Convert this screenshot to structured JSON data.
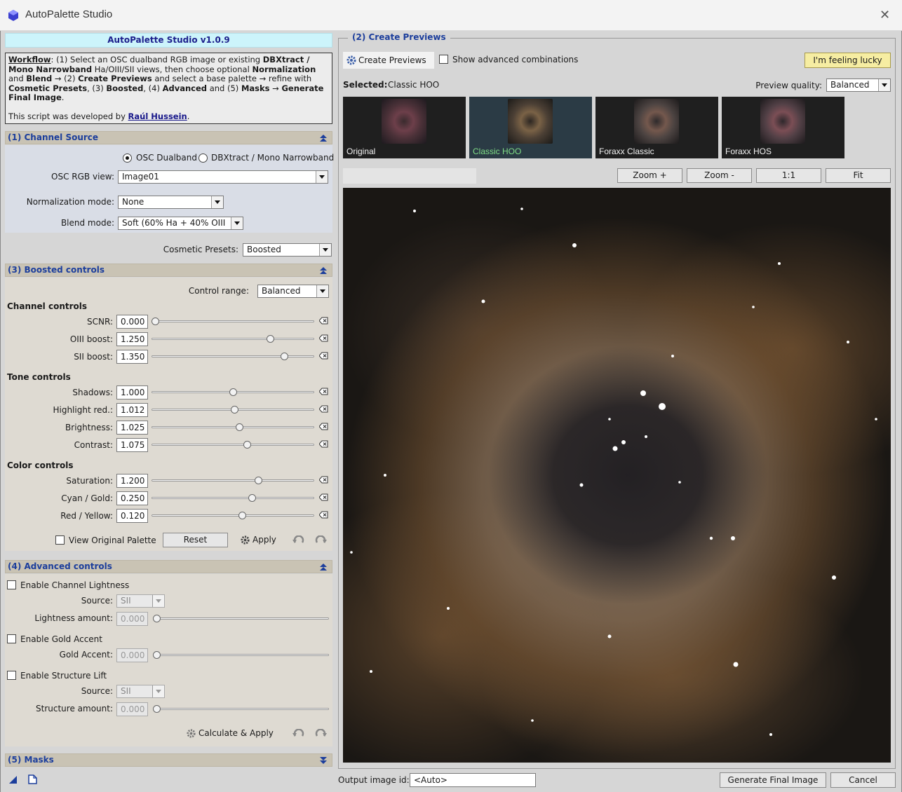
{
  "window": {
    "title": "AutoPalette Studio"
  },
  "banner": "AutoPalette Studio v1.0.9",
  "workflow": {
    "workflow_label": "Workflow",
    "text1": ": (1) Select an OSC dualband RGB image or existing ",
    "b1": "DBXtract / Mono Narrowband",
    "text2": " Ha/OIII/SII views, then choose optional ",
    "b2": "Normalization",
    "text3": " and ",
    "b3": "Blend",
    "text4": " → (2) ",
    "b4": "Create Previews",
    "text5": " and select a base palette → refine with ",
    "b5": "Cosmetic Presets",
    "text6": ", (3) ",
    "b6": "Boosted",
    "text7": ", (4) ",
    "b7": "Advanced",
    "text8": " and (5) ",
    "b8": "Masks",
    "text9": " → ",
    "b9": "Generate Final Image",
    "text10": ".",
    "dev_text": "This script was developed by ",
    "dev_name": "Raúl Hussein",
    "dev_end": "."
  },
  "channel_source": {
    "header": "(1) Channel Source",
    "radio_osc": "OSC Dualband",
    "radio_dbx": "DBXtract / Mono Narrowband",
    "osc_view_label": "OSC RGB view:",
    "osc_view_value": "Image01",
    "norm_label": "Normalization mode:",
    "norm_value": "None",
    "blend_label": "Blend mode:",
    "blend_value": "Soft (60% Ha + 40% OIII"
  },
  "cosmetic": {
    "label": "Cosmetic Presets:",
    "value": "Boosted"
  },
  "boosted": {
    "header": "(3) Boosted controls",
    "range_label": "Control range:",
    "range_value": "Balanced",
    "channel_title": "Channel controls",
    "tone_title": "Tone controls",
    "color_title": "Color controls",
    "sliders": [
      {
        "label": "SCNR:",
        "value": "0.000",
        "pos": 0.0
      },
      {
        "label": "OIII boost:",
        "value": "1.250",
        "pos": 0.74
      },
      {
        "label": "SII boost:",
        "value": "1.350",
        "pos": 0.83
      },
      {
        "label": "Shadows:",
        "value": "1.000",
        "pos": 0.5
      },
      {
        "label": "Highlight red.:",
        "value": "1.012",
        "pos": 0.51
      },
      {
        "label": "Brightness:",
        "value": "1.025",
        "pos": 0.54
      },
      {
        "label": "Contrast:",
        "value": "1.075",
        "pos": 0.59
      },
      {
        "label": "Saturation:",
        "value": "1.200",
        "pos": 0.66
      },
      {
        "label": "Cyan / Gold:",
        "value": "0.250",
        "pos": 0.62
      },
      {
        "label": "Red / Yellow:",
        "value": "0.120",
        "pos": 0.56
      }
    ],
    "view_original": "View Original Palette",
    "reset": "Reset",
    "apply": "Apply"
  },
  "advanced": {
    "header": "(4) Advanced controls",
    "enable_lightness": "Enable Channel Lightness",
    "source_label": "Source:",
    "source_value": "SII",
    "lightness_label": "Lightness amount:",
    "lightness_value": "0.000",
    "enable_gold": "Enable Gold Accent",
    "gold_label": "Gold Accent:",
    "gold_value": "0.000",
    "enable_structure": "Enable Structure Lift",
    "source2_label": "Source:",
    "source2_value": "SII",
    "structure_label": "Structure amount:",
    "structure_value": "0.000",
    "calc_apply": "Calculate & Apply"
  },
  "masks": {
    "header": "(5) Masks"
  },
  "previews": {
    "legend": "(2) Create Previews",
    "create_btn": "Create Previews",
    "show_adv": "Show advanced combinations",
    "lucky": "I'm feeling lucky",
    "selected_label": "Selected:",
    "selected_value": "Classic HOO",
    "quality_label": "Preview quality:",
    "quality_value": "Balanced",
    "thumbs": [
      "Original",
      "Classic HOO",
      "Foraxx Classic",
      "Foraxx HOS"
    ],
    "zoom_in": "Zoom +",
    "zoom_out": "Zoom -",
    "one_to_one": "1:1",
    "fit": "Fit"
  },
  "footer": {
    "output_label": "Output image id:",
    "output_value": "<Auto>",
    "generate": "Generate Final Image",
    "cancel": "Cancel"
  },
  "colors": {
    "accent_text": "#1c3e9c",
    "lucky_bg": "#f6eda2",
    "selected_green": "#7fdc86"
  }
}
